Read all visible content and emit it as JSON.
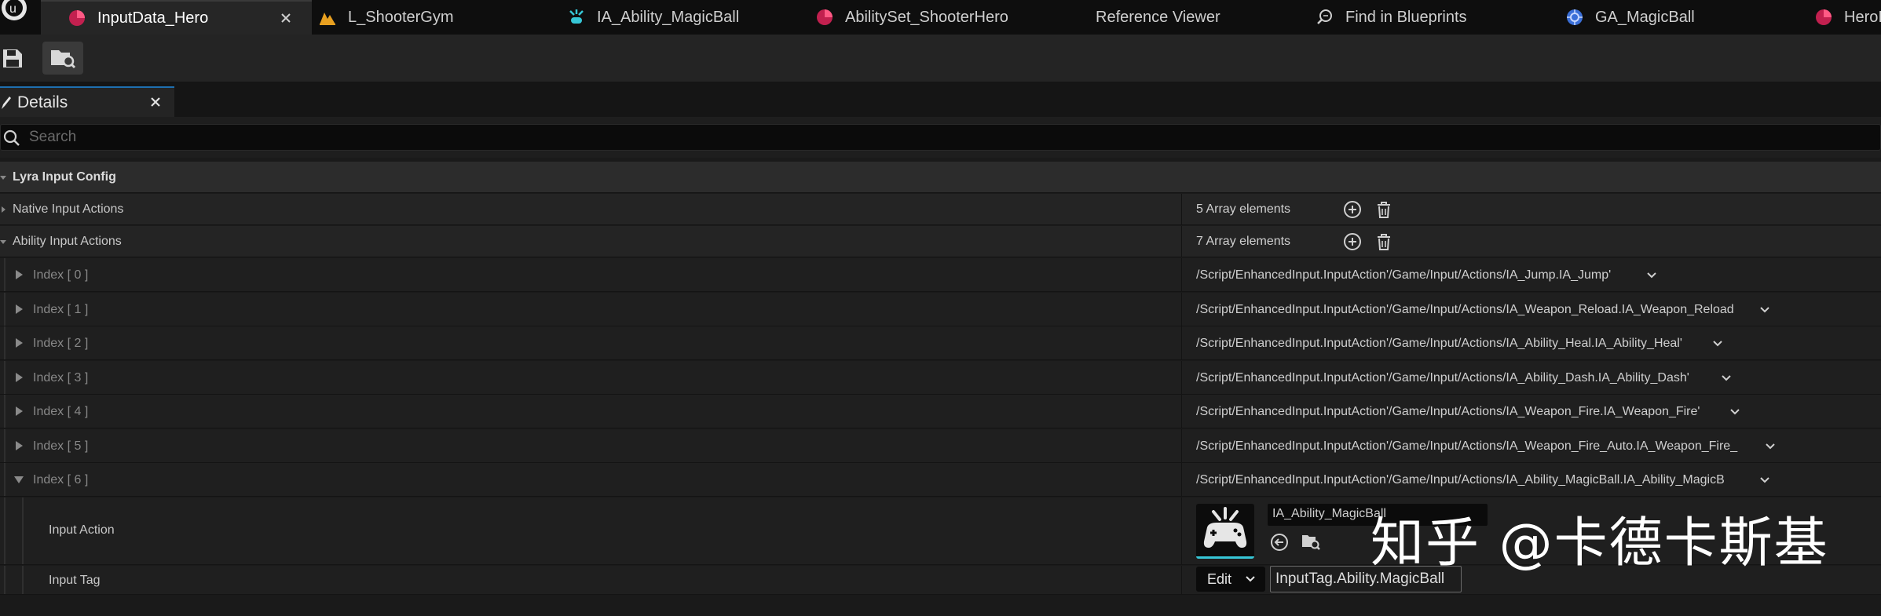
{
  "tabs": [
    {
      "label": "InputData_Hero",
      "icon": "data-asset-icon"
    },
    {
      "label": "L_ShooterGym",
      "icon": "level-icon"
    },
    {
      "label": "IA_Ability_MagicBall",
      "icon": "input-action-icon"
    },
    {
      "label": "AbilitySet_ShooterHero",
      "icon": "data-asset-icon"
    },
    {
      "label": "Reference Viewer",
      "icon": ""
    },
    {
      "label": "Find in Blueprints",
      "icon": "find-icon"
    },
    {
      "label": "GA_MagicBall",
      "icon": "blueprint-icon"
    },
    {
      "label": "HeroI",
      "icon": "data-asset-icon"
    }
  ],
  "details": {
    "tab_label": "Details",
    "search_placeholder": "Search",
    "category": "Lyra Input Config",
    "native_input_actions": {
      "label": "Native Input Actions",
      "value": "5 Array elements"
    },
    "ability_input_actions": {
      "label": "Ability Input Actions",
      "value": "7 Array elements"
    },
    "indices": [
      {
        "label": "Index [ 0 ]",
        "value": "/Script/EnhancedInput.InputAction'/Game/Input/Actions/IA_Jump.IA_Jump'"
      },
      {
        "label": "Index [ 1 ]",
        "value": "/Script/EnhancedInput.InputAction'/Game/Input/Actions/IA_Weapon_Reload.IA_Weapon_Reload"
      },
      {
        "label": "Index [ 2 ]",
        "value": "/Script/EnhancedInput.InputAction'/Game/Input/Actions/IA_Ability_Heal.IA_Ability_Heal'"
      },
      {
        "label": "Index [ 3 ]",
        "value": "/Script/EnhancedInput.InputAction'/Game/Input/Actions/IA_Ability_Dash.IA_Ability_Dash'"
      },
      {
        "label": "Index [ 4 ]",
        "value": "/Script/EnhancedInput.InputAction'/Game/Input/Actions/IA_Weapon_Fire.IA_Weapon_Fire'"
      },
      {
        "label": "Index [ 5 ]",
        "value": "/Script/EnhancedInput.InputAction'/Game/Input/Actions/IA_Weapon_Fire_Auto.IA_Weapon_Fire_"
      },
      {
        "label": "Index [ 6 ]",
        "value": "/Script/EnhancedInput.InputAction'/Game/Input/Actions/IA_Ability_MagicBall.IA_Ability_MagicB"
      }
    ],
    "input_action": {
      "label": "Input Action",
      "asset_name": "IA_Ability_MagicBall"
    },
    "input_tag": {
      "label": "Input Tag",
      "edit_label": "Edit",
      "value": "InputTag.Ability.MagicBall"
    }
  },
  "watermark": "知乎 @卡德卡斯基",
  "colors": {
    "accent_blue": "#1e6fb0",
    "thumb_cyan": "#36c6d6",
    "data_asset_pink": "#c2204f",
    "level_orange": "#e8a020"
  }
}
